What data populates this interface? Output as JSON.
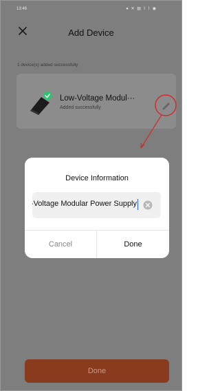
{
  "status_bar": {
    "time": "13:46",
    "icons": "● ✕ ▤ ⌇ ⌇ ◉"
  },
  "header": {
    "title": "Add Device",
    "close_icon": "close-icon"
  },
  "added_message": "1 device(s) added successfully",
  "device": {
    "name": "Low-Voltage Modul···",
    "status": "Added successfully",
    "check_color": "#28c76f"
  },
  "dialog": {
    "title": "Device Information",
    "input_value": "Low-Voltage Modular Power Supply",
    "cancel_label": "Cancel",
    "done_label": "Done"
  },
  "bottom_button": {
    "label": "Done"
  },
  "colors": {
    "overlay": "#7e7e7e",
    "accent": "#e2572c",
    "annotation": "#d22a2a"
  }
}
